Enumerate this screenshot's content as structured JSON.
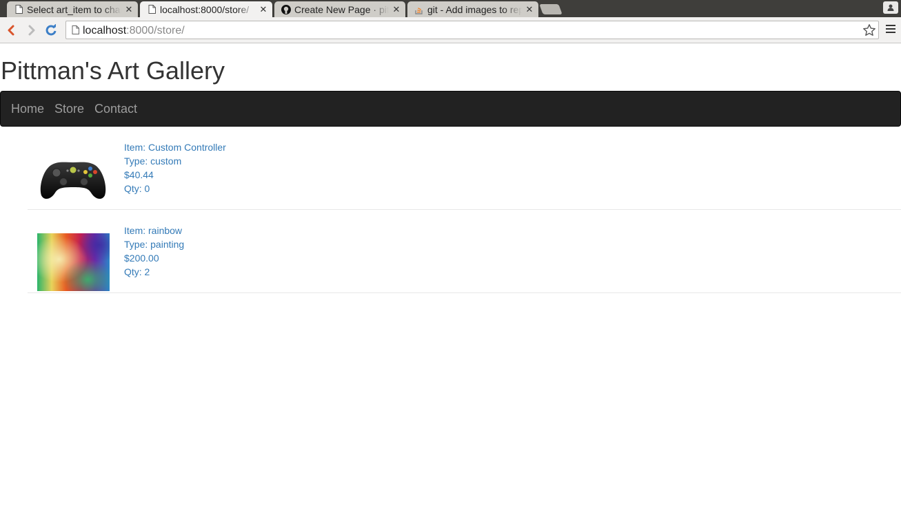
{
  "browser": {
    "tabs": [
      {
        "title": "Select art_item to change",
        "icon": "page-icon",
        "active": false
      },
      {
        "title": "localhost:8000/store/",
        "icon": "page-icon",
        "active": true
      },
      {
        "title": "Create New Page · pittman",
        "icon": "github-icon",
        "active": false
      },
      {
        "title": "git - Add images to repo",
        "icon": "stackoverflow-icon",
        "active": false
      }
    ],
    "url_host": "localhost",
    "url_rest": ":8000/store/"
  },
  "site": {
    "title": "Pittman's Art Gallery",
    "nav": [
      "Home",
      "Store",
      "Contact"
    ]
  },
  "items": [
    {
      "item": "Item: Custom Controller",
      "type": "Type: custom",
      "price": "$40.44",
      "qty": "Qty: 0",
      "image": "game-controller"
    },
    {
      "item": "Item: rainbow",
      "type": "Type: painting",
      "price": "$200.00",
      "qty": "Qty: 2",
      "image": "rainbow-painting"
    }
  ],
  "colors": {
    "link": "#337ab7",
    "navbar_bg": "#222222",
    "navbar_link": "#9d9d9d"
  }
}
